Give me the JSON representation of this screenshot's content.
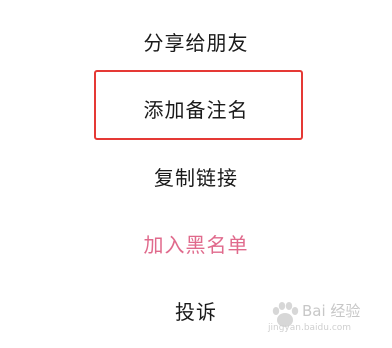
{
  "menu": {
    "items": [
      {
        "label": "分享给朋友"
      },
      {
        "label": "添加备注名"
      },
      {
        "label": "复制链接"
      },
      {
        "label": "加入黑名单"
      },
      {
        "label": "投诉"
      }
    ]
  },
  "colors": {
    "text": "#1a1a1a",
    "danger": "#e06a8c",
    "highlight": "#e53935",
    "background": "#ffffff"
  },
  "watermark": {
    "text": "Bai 经验",
    "url": "jingyan.baidu.com"
  }
}
